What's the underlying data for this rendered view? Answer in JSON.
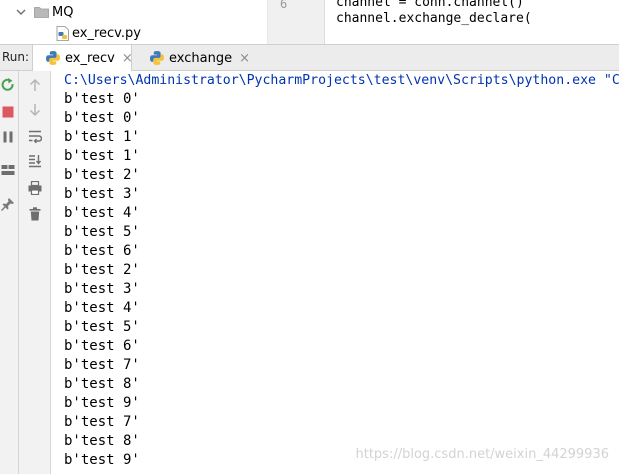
{
  "project_tree": {
    "folder_name": "MQ",
    "file_name": "ex_recv.py"
  },
  "editor": {
    "line_number": "6",
    "line_1": "channel = conn.channel()",
    "line_2": "channel.exchange_declare("
  },
  "run_panel": {
    "label": "Run:",
    "tabs": [
      {
        "label": "ex_recv",
        "active": true
      },
      {
        "label": "exchange",
        "active": false
      }
    ],
    "close_glyph": "×"
  },
  "console": {
    "command": "C:\\Users\\Administrator\\PycharmProjects\\test\\venv\\Scripts\\python.exe \"C",
    "lines": [
      "b'test 0'",
      "b'test 0'",
      "b'test 1'",
      "b'test 1'",
      "b'test 2'",
      "b'test 3'",
      "b'test 4'",
      "b'test 5'",
      "b'test 6'",
      "b'test 2'",
      "b'test 3'",
      "b'test 4'",
      "b'test 5'",
      "b'test 6'",
      "b'test 7'",
      "b'test 8'",
      "b'test 9'",
      "b'test 7'",
      "b'test 8'",
      "b'test 9'"
    ]
  },
  "watermark": "https://blog.csdn.net/weixin_44299936",
  "colors": {
    "command_text": "#0033b3",
    "rerun_green": "#4aa256",
    "stop_red": "#db5860",
    "python_blue": "#3d7ab7",
    "python_yellow": "#f5c33b"
  },
  "icons": {
    "tree_chevron": "chevron-down-icon",
    "folder": "folder-icon",
    "python_file": "python-file-icon",
    "rerun": "rerun-icon",
    "stop": "stop-icon",
    "pause": "pause-icon",
    "layout": "layout-icon",
    "pin": "pin-icon",
    "up": "arrow-up-icon",
    "down": "arrow-down-icon",
    "soft_wrap": "soft-wrap-icon",
    "scroll_to_end": "scroll-to-end-icon",
    "print": "print-icon",
    "trash": "trash-icon"
  }
}
